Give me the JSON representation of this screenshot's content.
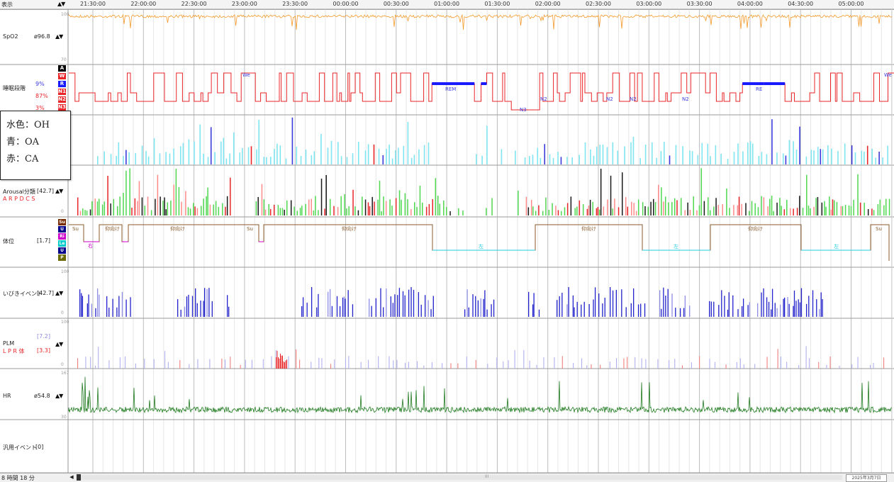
{
  "header": {
    "display_label": "表示",
    "sort_arrows": "▲▼"
  },
  "timeline": {
    "ticks": [
      "21:30:00",
      "22:00:00",
      "22:30:00",
      "23:00:00",
      "23:30:00",
      "00:00:00",
      "00:30:00",
      "01:00:00",
      "01:30:00",
      "02:00:00",
      "02:30:00",
      "03:00:00",
      "03:30:00",
      "04:00:00",
      "04:30:00",
      "05:00:00"
    ]
  },
  "tracks": {
    "spo2": {
      "label": "SpO2",
      "value": "ø96.8",
      "arrows": "▲▼",
      "scale_top": "100",
      "scale_bottom": "70",
      "color": "#f39a2a"
    },
    "sleep_stage": {
      "label": "睡眠段階",
      "pct_r": "9%",
      "pct_n": "87%",
      "pct_low": "3%",
      "color": "#e8262a",
      "keys": [
        "A",
        "W",
        "R",
        "N1",
        "N2",
        "N3"
      ],
      "key_colors": [
        "#000000",
        "#e8262a",
        "#1a1aff",
        "#e8262a",
        "#e8262a",
        "#e8262a"
      ],
      "annotations": [
        "We",
        "REM",
        "N3",
        "N2",
        "N2",
        "N2",
        "N2",
        "RE",
        "We"
      ]
    },
    "respiratory": {
      "scale_top": "",
      "color_oh": "#7fe5f0",
      "color_oa": "#3b3bdc",
      "color_ca": "#e8262a"
    },
    "arousal": {
      "label": "Arousal分類",
      "value": "[42.7]",
      "arrows": "▲▼",
      "sub_label": "A R P D C S",
      "scale_bottom": "0"
    },
    "position": {
      "label": "体位",
      "value": "[1.7]",
      "keys": [
        "Su",
        "U",
        "Ri",
        "Le",
        "U",
        "P"
      ],
      "key_colors": [
        "#7b2b00",
        "#00008b",
        "#cc00cc",
        "#00cccc",
        "#00008b",
        "#6b6b00"
      ],
      "annotations": [
        "Su",
        "右",
        "仰向け",
        "仰向け",
        "Su",
        "仰向け",
        "左",
        "仰向け",
        "左",
        "仰向け",
        "左",
        "Su"
      ]
    },
    "snore": {
      "label": "いびきイベント",
      "value": "[42.7]",
      "arrows": "▲▼",
      "scale_top": "100",
      "scale_bottom": "0",
      "color": "#2222cc"
    },
    "plm": {
      "label": "PLM",
      "value_top": "[7.2]",
      "sub_label": "L P R 体",
      "value_bottom": "[3.3]",
      "arrows": "▲▼",
      "scale_top": "100",
      "scale_bottom": "0"
    },
    "hr": {
      "label": "HR",
      "value": "ø54.8",
      "arrows": "▲▼",
      "scale_top": "167",
      "scale_bottom": "30",
      "color": "#1f7a1f"
    },
    "general": {
      "label": "汎用イベント",
      "value": "[0]"
    }
  },
  "legend": {
    "line1": "水色：OH",
    "line2": "青：OA",
    "line3": "赤：CA"
  },
  "footer": {
    "duration": "8 時間 18 分",
    "date": "2025年3月7日",
    "scroll_left": "◀",
    "scroll_mid": "III"
  }
}
